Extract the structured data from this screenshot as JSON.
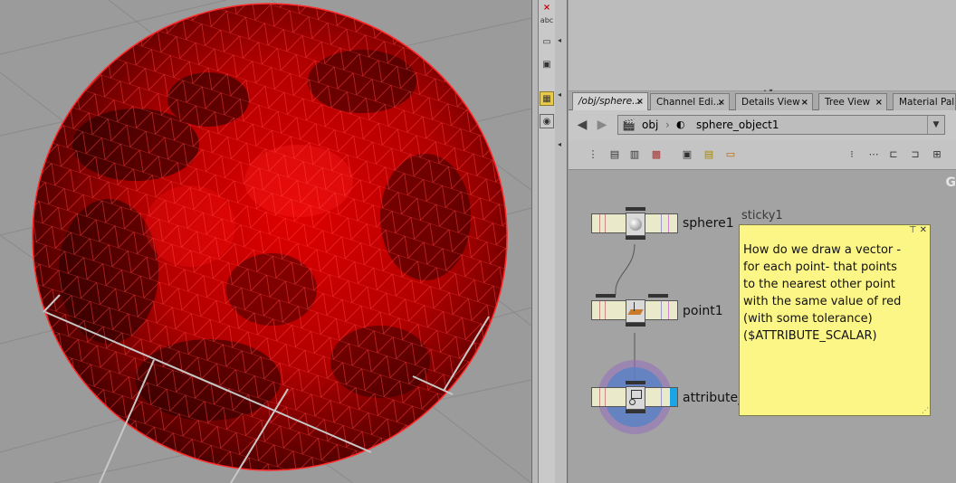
{
  "network": {
    "tabs": [
      {
        "label": "/obj/sphere...",
        "close": "×"
      },
      {
        "label": "Channel Edi...",
        "close": "×"
      },
      {
        "label": "Details View",
        "close": "×"
      },
      {
        "label": "Tree View",
        "close": "×"
      },
      {
        "label": "Material Pal...",
        "close": ""
      }
    ],
    "path": {
      "root": "obj",
      "current": "sphere_object1"
    },
    "nodes": [
      {
        "name": "sphere1"
      },
      {
        "name": "point1"
      },
      {
        "name": "attribute_scalar"
      }
    ],
    "sticky": {
      "name": "sticky1",
      "text": "How do we draw a vector -\nfor each point- that points\nto the nearest other point\nwith the same value of red\n(with some tolerance)\n($ATTRIBUTE_SCALAR)"
    },
    "edge_letter": "G"
  },
  "toolbar": {
    "abc_label": "abc"
  },
  "colors": {
    "sphere": "#d40000",
    "sticky": "#fcf686",
    "node_body": "#eaeacb",
    "render_flag": "#1aa6e6"
  }
}
